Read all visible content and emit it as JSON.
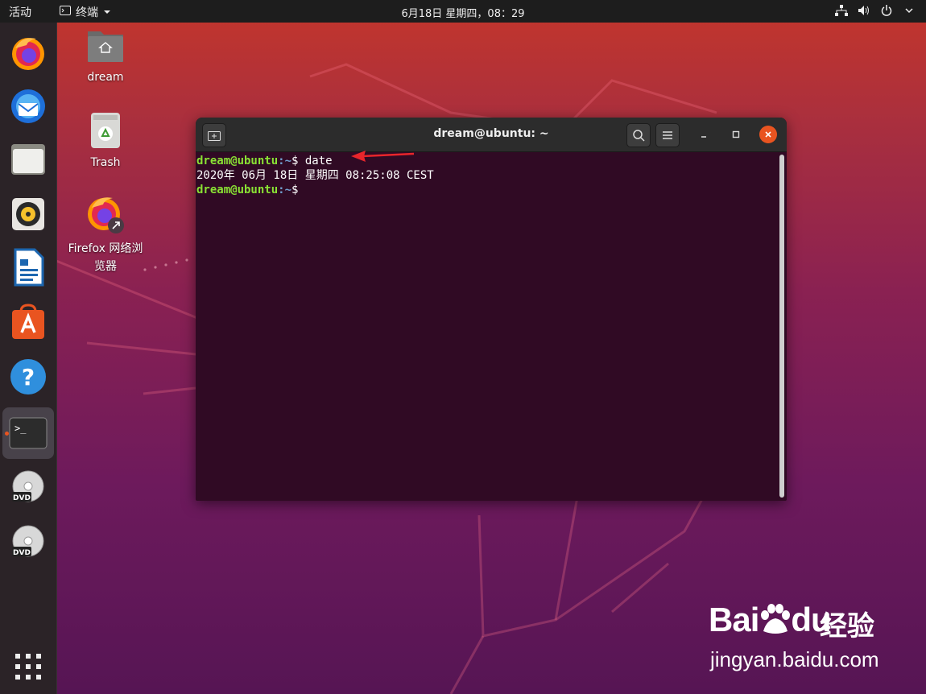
{
  "topbar": {
    "activities": "活动",
    "app_name": "终端",
    "clock": "6月18日 星期四，08：29",
    "tray_icons": [
      "network-icon",
      "volume-icon",
      "power-icon",
      "chevron-down-icon"
    ]
  },
  "dock": {
    "items": [
      "firefox",
      "thunderbird",
      "files",
      "rhythmbox",
      "libreoffice-writer",
      "software",
      "help",
      "terminal",
      "dvd",
      "dvd"
    ],
    "active": "terminal",
    "apps_grid": "show-applications"
  },
  "desktop": {
    "icons": [
      {
        "label": "dream"
      },
      {
        "label": "Trash"
      },
      {
        "label": "Firefox 网络浏览器"
      }
    ]
  },
  "terminal": {
    "title": "dream@ubuntu: ~",
    "lines": [
      {
        "user": "dream@ubuntu",
        "path": ":~",
        "prompt": "$ ",
        "cmd": "date"
      },
      {
        "output": "2020年 06月 18日 星期四 08:25:08 CEST"
      },
      {
        "user": "dream@ubuntu",
        "path": ":~",
        "prompt": "$ ",
        "cmd": ""
      }
    ]
  },
  "watermark": {
    "brand": "Bai",
    "brand2": "du",
    "suffix": "经验",
    "url": "jingyan.baidu.com"
  },
  "colors": {
    "accent": "#e95420",
    "terminal_bg": "#300a24",
    "prompt_user": "#8ae234",
    "prompt_path": "#729fcf"
  }
}
